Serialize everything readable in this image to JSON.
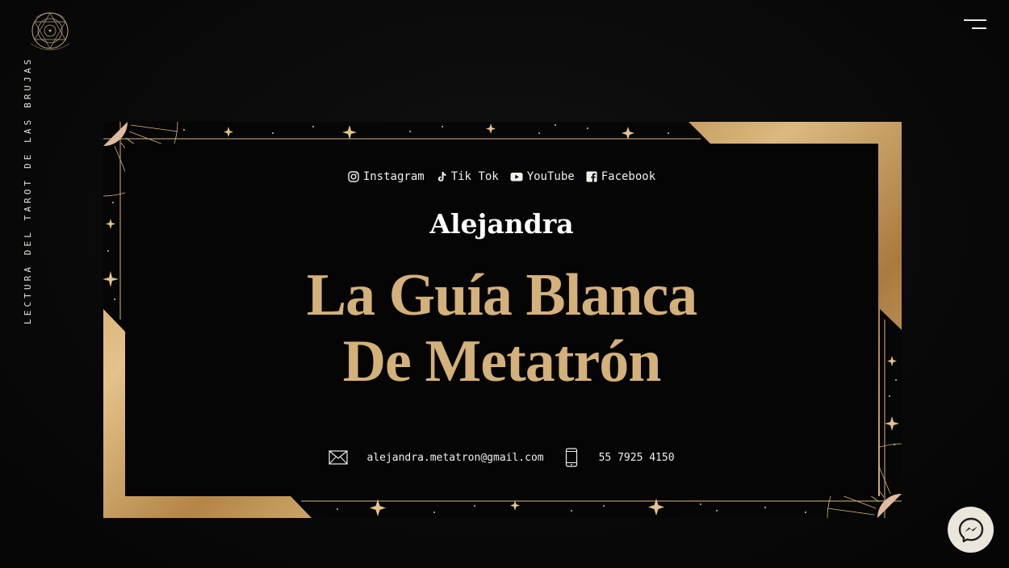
{
  "logo": {
    "text_top": "LA GUÍA BLANCA",
    "text_bottom": "METATRÓN"
  },
  "tagline": "LECTURA DEL TAROT DE LAS BRUJAS",
  "card": {
    "social_links": [
      {
        "label": "Instagram",
        "icon": "instagram-icon"
      },
      {
        "label": "Tik Tok",
        "icon": "tiktok-icon"
      },
      {
        "label": "YouTube",
        "icon": "youtube-icon"
      },
      {
        "label": "Facebook",
        "icon": "facebook-icon"
      }
    ],
    "name": "Alejandra",
    "title_line1": "La Guía Blanca",
    "title_line2": "De Metatrón",
    "email": "alejandra.metatron@gmail.com",
    "phone": "55 7925 4150"
  },
  "colors": {
    "background": "#0a0a0a",
    "gold": "#d4b07a",
    "text": "#f1efe9"
  }
}
